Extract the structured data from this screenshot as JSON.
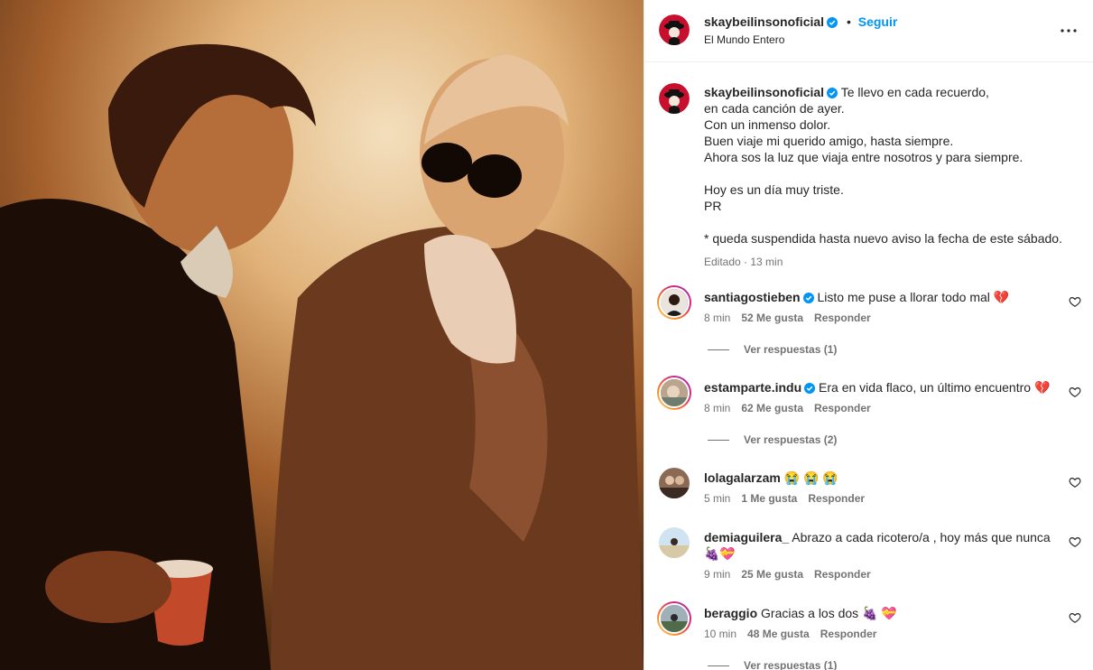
{
  "post": {
    "author": "skaybeilinsonoficial",
    "location": "El Mundo Entero",
    "follow_label": "Seguir",
    "separator": "•",
    "more_icon": "more-horizontal-icon",
    "caption": "Te llevo en cada recuerdo,\nen cada canción de ayer.\nCon un inmenso dolor.\nBuen viaje mi querido amigo, hasta siempre.\nAhora sos la luz que viaja entre nosotros y para siempre.\n\nHoy es un día muy triste.\nPR\n\n* queda suspendida hasta nuevo aviso la fecha de este sábado.",
    "edited": "Editado",
    "time": "13 min"
  },
  "comments": [
    {
      "user": "santiagostieben",
      "verified": true,
      "text": "Listo me puse a llorar todo mal 💔",
      "time": "8 min",
      "likes": "52 Me gusta",
      "reply": "Responder",
      "view_replies": "Ver respuestas (1)"
    },
    {
      "user": "estamparte.indu",
      "verified": true,
      "text": "Era en vida flaco, un último encuentro 💔",
      "time": "8 min",
      "likes": "62 Me gusta",
      "reply": "Responder",
      "view_replies": "Ver respuestas (2)"
    },
    {
      "user": "lolagalarzam",
      "verified": false,
      "text": "😭 😭 😭",
      "time": "5 min",
      "likes": "1 Me gusta",
      "reply": "Responder"
    },
    {
      "user": "demiaguilera_",
      "verified": false,
      "text": "Abrazo a cada ricotero/a , hoy más que nunca 🍇💝",
      "time": "9 min",
      "likes": "25 Me gusta",
      "reply": "Responder"
    },
    {
      "user": "beraggio",
      "verified": false,
      "text": "Gracias a los dos 🍇 💝",
      "time": "10 min",
      "likes": "48 Me gusta",
      "reply": "Responder",
      "view_replies": "Ver respuestas (1)"
    }
  ],
  "colors": {
    "accent": "#0095f6",
    "verified": "#0095f6",
    "muted": "#737373"
  }
}
